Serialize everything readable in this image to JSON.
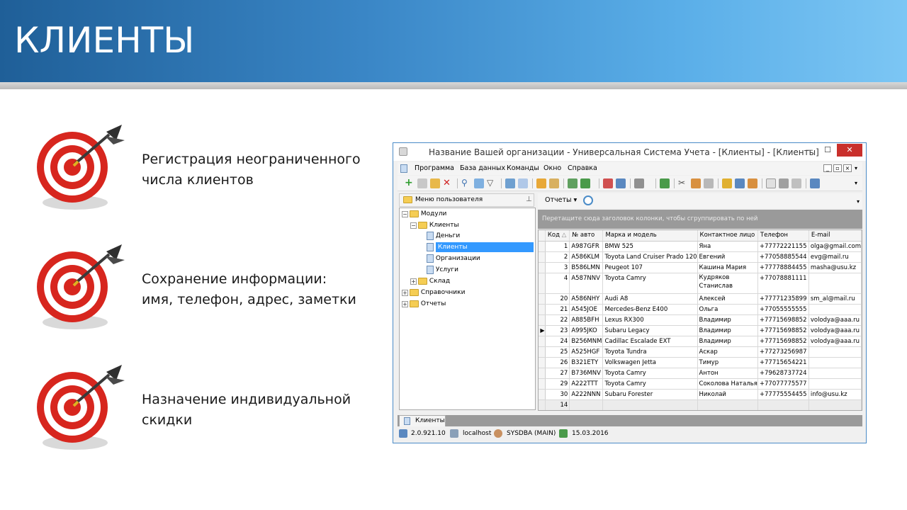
{
  "slide": {
    "title": "КЛИЕНТЫ",
    "features": [
      {
        "line1": "Регистрация неограниченного",
        "line2": "числа клиентов"
      },
      {
        "line1": "Сохранение информации:",
        "line2": "имя, телефон, адрес, заметки"
      },
      {
        "line1": "Назначение индивидуальной",
        "line2": "скидки"
      }
    ]
  },
  "window": {
    "title": "Название Вашей организации - Универсальная Система Учета - [Клиенты] - [Клиенты]",
    "controls": {
      "minimize": "—",
      "maximize": "☐",
      "close": "✕"
    },
    "menu": [
      "Программа",
      "База данных",
      "Команды",
      "Окно",
      "Справка"
    ],
    "mdi_controls": [
      "_",
      "▫",
      "×"
    ],
    "tree": {
      "header": "Меню пользователя",
      "nodes": [
        {
          "label": "Модули"
        },
        {
          "label": "Клиенты"
        },
        {
          "label": "Деньги"
        },
        {
          "label": "Клиенты"
        },
        {
          "label": "Организации"
        },
        {
          "label": "Услуги"
        },
        {
          "label": "Склад"
        },
        {
          "label": "Справочники"
        },
        {
          "label": "Отчеты"
        }
      ]
    },
    "reports_button": "Отчеты",
    "group_hint": "Перетащите сюда заголовок колонки, чтобы сгруппировать по ней",
    "grid": {
      "columns": [
        "Код",
        "№ авто",
        "Марка и модель",
        "Контактное лицо",
        "Телефон",
        "E-mail"
      ],
      "sort_indicator": "△",
      "rows": [
        [
          "1",
          "A987GFR",
          "BMW 525",
          "Яна",
          "+77772221155",
          "olga@gmail.com"
        ],
        [
          "2",
          "A586KLM",
          "Toyota Land Cruiser Prado 120",
          "Евгений",
          "+77058885544",
          "evg@mail.ru"
        ],
        [
          "3",
          "B586LMN",
          "Peugeot 107",
          "Кашина Мария",
          "+77778884455",
          "masha@usu.kz"
        ],
        [
          "4",
          "A587NNV",
          "Toyota Camry",
          "Кудряков Станислав",
          "+77078881111",
          ""
        ],
        [
          "20",
          "A586NHY",
          "Audi A8",
          "Алексей",
          "+77771235899",
          "sm_al@mail.ru"
        ],
        [
          "21",
          "A545JOE",
          "Mercedes-Benz E400",
          "Ольга",
          "+77055555555",
          ""
        ],
        [
          "22",
          "A885BFH",
          "Lexus RX300",
          "Владимир",
          "+77715698852",
          "volodya@aaa.ru"
        ],
        [
          "23",
          "A995JKO",
          "Subaru Legacy",
          "Владимир",
          "+77715698852",
          "volodya@aaa.ru"
        ],
        [
          "24",
          "B256MNM",
          "Cadillac Escalade EXT",
          "Владимир",
          "+77715698852",
          "volodya@aaa.ru"
        ],
        [
          "25",
          "A525HGF",
          "Toyota Tundra",
          "Аскар",
          "+77273256987",
          ""
        ],
        [
          "26",
          "B321ETY",
          "Volkswagen Jetta",
          "Тимур",
          "+77715654221",
          ""
        ],
        [
          "27",
          "B736MNV",
          "Toyota Camry",
          "Антон",
          "+79628737724",
          ""
        ],
        [
          "29",
          "A222TTT",
          "Toyota Camry",
          "Соколова Наталья",
          "+77077775577",
          ""
        ],
        [
          "30",
          "A222NNN",
          "Subaru Forester",
          "Николай",
          "+77775554455",
          "info@usu.kz"
        ]
      ],
      "current_row_marker": "▶",
      "current_row_index": 7,
      "count": "14"
    },
    "tab": "Клиенты",
    "status": {
      "version": "2.0.921.10",
      "server": "localhost",
      "user": "SYSDBA (MAIN)",
      "date": "15.03.2016"
    },
    "colors": {
      "accent": "#3399ff",
      "close": "#c9302c",
      "header_start": "#1f5f98",
      "header_end": "#7cc6f4"
    }
  }
}
